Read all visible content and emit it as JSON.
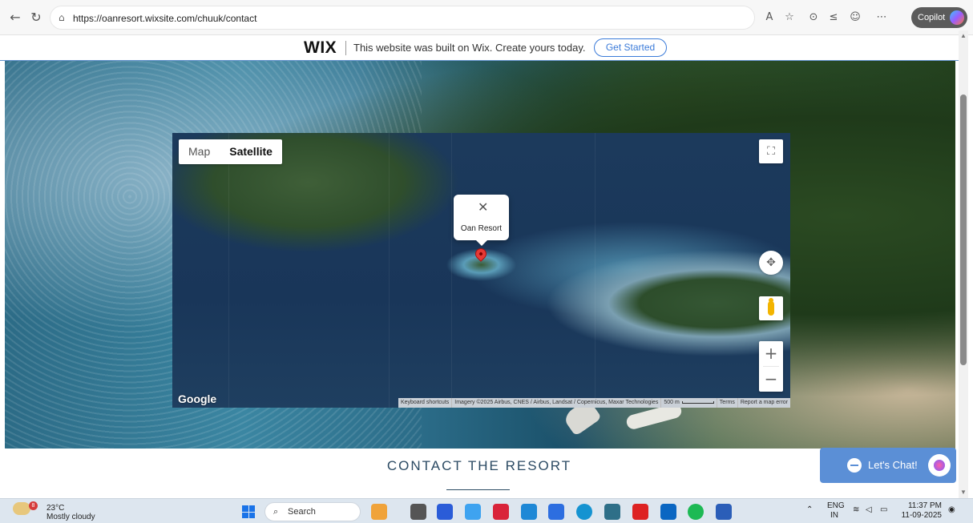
{
  "browser": {
    "url": "https://oanresort.wixsite.com/chuuk/contact",
    "copilot_label": "Copilot"
  },
  "wix_banner": {
    "logo": "WIX",
    "message": "This website was built on Wix. Create yours today.",
    "cta": "Get Started"
  },
  "map": {
    "type_map": "Map",
    "type_satellite": "Satellite",
    "popup_label": "Oan Resort",
    "zoom_in": "+",
    "zoom_out": "−",
    "brand": "Google",
    "attribution": {
      "shortcuts": "Keyboard shortcuts",
      "imagery": "Imagery ©2025 Airbus, CNES / Airbus, Landsat / Copernicus, Maxar Technologies",
      "scale": "500 m",
      "terms": "Terms",
      "report": "Report a map error"
    }
  },
  "page": {
    "contact_title": "CONTACT THE RESORT",
    "chat_label": "Let's Chat!"
  },
  "taskbar": {
    "weather_badge": "8",
    "temperature": "23°C",
    "weather_desc": "Mostly cloudy",
    "search_label": "Search",
    "lang_top": "ENG",
    "lang_bottom": "IN",
    "time": "11:37 PM",
    "date": "11-09-2025"
  }
}
